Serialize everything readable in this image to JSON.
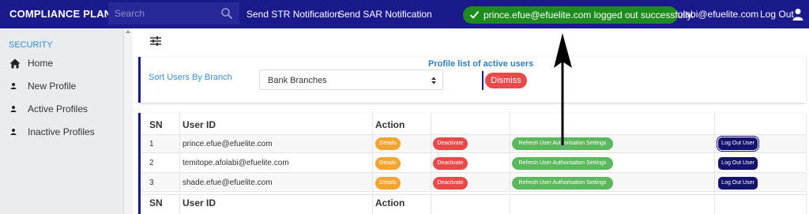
{
  "app": {
    "title": "COMPLIANCE PLANET"
  },
  "header": {
    "search": {
      "placeholder": "Search",
      "icon": "search-icon"
    },
    "nav": {
      "send_str": "Send STR Notification",
      "send_sar": "Send SAR Notification"
    },
    "user_email": "olabi@efuelite.com",
    "logout_label": "Log Out",
    "bg_color": "#1a1a8c"
  },
  "toast": {
    "message": "prince.efue@efuelite.com logged out successfully.",
    "icon": "check-icon",
    "color": "#1e8b1e"
  },
  "sidebar": {
    "heading": "SECURITY",
    "items": [
      {
        "label": "Home",
        "icon": "home-icon"
      },
      {
        "label": "New Profile",
        "icon": "person-icon"
      },
      {
        "label": "Active Profiles",
        "icon": "person-icon"
      },
      {
        "label": "Inactive Profiles",
        "icon": "person-icon"
      }
    ]
  },
  "filter": {
    "sort_label": "Sort Users By Branch",
    "branch_select_value": "Bank Branches",
    "profile_heading": "Profile list of active users",
    "dismiss_label": "Dismiss"
  },
  "table": {
    "headers": [
      "SN",
      "User ID",
      "Action"
    ],
    "rows": [
      {
        "sn": "1",
        "user_id": "prince.efue@efuelite.com"
      },
      {
        "sn": "2",
        "user_id": "temitope.afolabi@efuelite.com"
      },
      {
        "sn": "3",
        "user_id": "shade.efue@efuelite.com"
      }
    ],
    "actions": {
      "details": "Details",
      "deactivate": "Deactivate",
      "refresh": "Refresh User Authorisation Settings",
      "logout": "Log Out User"
    },
    "footer_headers": [
      "SN",
      "User ID",
      "Action"
    ]
  }
}
